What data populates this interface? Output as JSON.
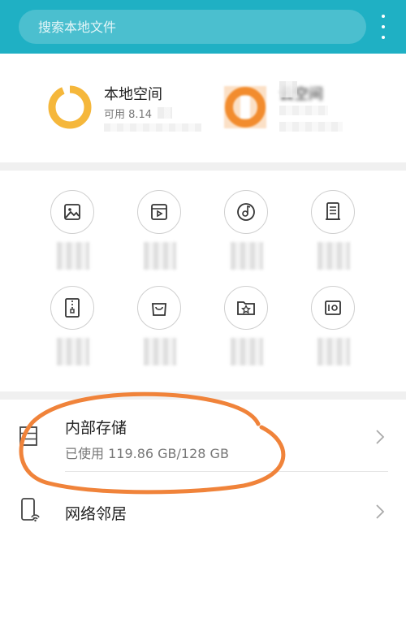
{
  "search": {
    "placeholder": "搜索本地文件"
  },
  "storage": {
    "local": {
      "title": "本地空间",
      "subtitle": "可用 8.14",
      "used_fraction": 0.94
    },
    "cloud": {
      "title": "云空间"
    }
  },
  "categories": [
    {
      "name": "image"
    },
    {
      "name": "video"
    },
    {
      "name": "music"
    },
    {
      "name": "document"
    },
    {
      "name": "archive"
    },
    {
      "name": "app-package"
    },
    {
      "name": "favorites"
    },
    {
      "name": "safe"
    }
  ],
  "list": {
    "internal": {
      "title": "内部存储",
      "subtitle": "已使用 119.86 GB/128 GB"
    },
    "network": {
      "title": "网络邻居"
    }
  },
  "colors": {
    "header": "#1fb0c4",
    "ring_local": "#f5b73b",
    "ring_cloud": "#f28c2e",
    "annotation": "#f0833a"
  }
}
